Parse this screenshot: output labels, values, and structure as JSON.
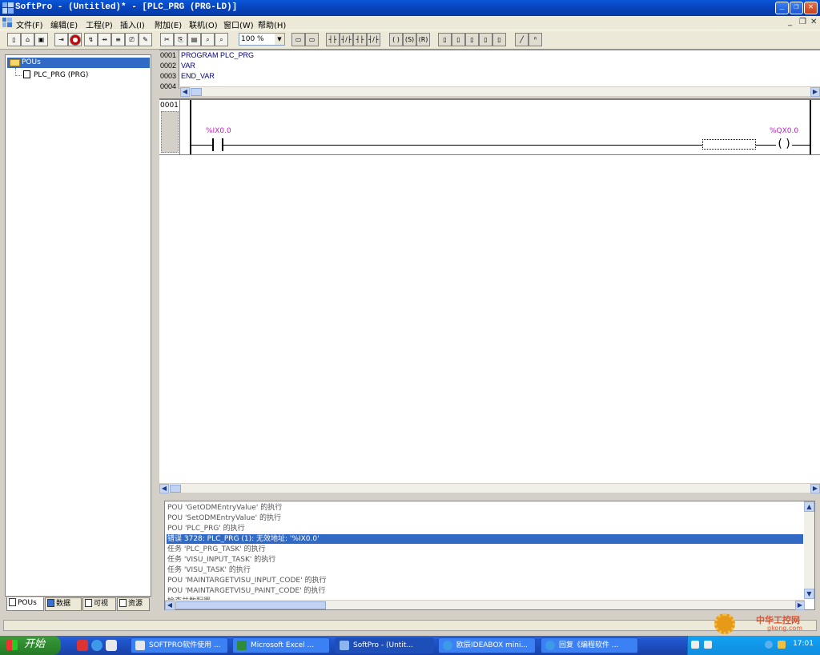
{
  "window": {
    "title": "SoftPro - (Untitled)* - [PLC_PRG (PRG-LD)]",
    "controls": {
      "minimize": "_",
      "maximize": "❐",
      "close": "✕"
    }
  },
  "menu": {
    "items": [
      "文件(F)",
      "编辑(E)",
      "工程(P)",
      "插入(I)",
      "附加(E)",
      "联机(O)",
      "窗口(W)",
      "帮助(H)"
    ],
    "mdi_controls": [
      "_",
      "❐",
      "✕"
    ]
  },
  "toolbar": {
    "zoom": "100 %"
  },
  "left_panel": {
    "root": "POUs",
    "child": "PLC_PRG (PRG)",
    "tabs": [
      "POUs",
      "数据",
      "可视",
      "资源"
    ]
  },
  "declaration": {
    "lines": [
      {
        "num": "0001",
        "code": "PROGRAM PLC_PRG"
      },
      {
        "num": "0002",
        "code": "VAR"
      },
      {
        "num": "0003",
        "code": "END_VAR"
      },
      {
        "num": "0004",
        "code": ""
      }
    ]
  },
  "ladder": {
    "rung_number": "0001",
    "contact_var": "%IX0.0",
    "coil_var": "%QX0.0",
    "coil_symbol": "( )"
  },
  "messages": {
    "lines": [
      "POU 'GetODMEntryValue' 的执行",
      "POU 'SetODMEntryValue' 的执行",
      "POU 'PLC_PRG' 的执行",
      "错误 3728: PLC_PRG (1): 无效地址: '%IX0.0'",
      "任务 'PLC_PRG_TASK' 的执行",
      "任务 'VISU_INPUT_TASK' 的执行",
      "任务 'VISU_TASK' 的执行",
      "POU 'MAINTARGETVISU_INPUT_CODE' 的执行",
      "POU 'MAINTARGETVISU_PAINT_CODE' 的执行",
      "检查并数配置"
    ],
    "selected_index": 3
  },
  "taskbar": {
    "start_label": "开始",
    "buttons": [
      "SOFTPRO软件使用 ...",
      "Microsoft Excel ...",
      "SoftPro - (Untit...",
      "欧辰IDEABOX mini...",
      "回复《编程软件 ..."
    ],
    "clock": "17:01"
  },
  "watermark": {
    "line1": "中华工控网",
    "line2": "gkong.com"
  }
}
